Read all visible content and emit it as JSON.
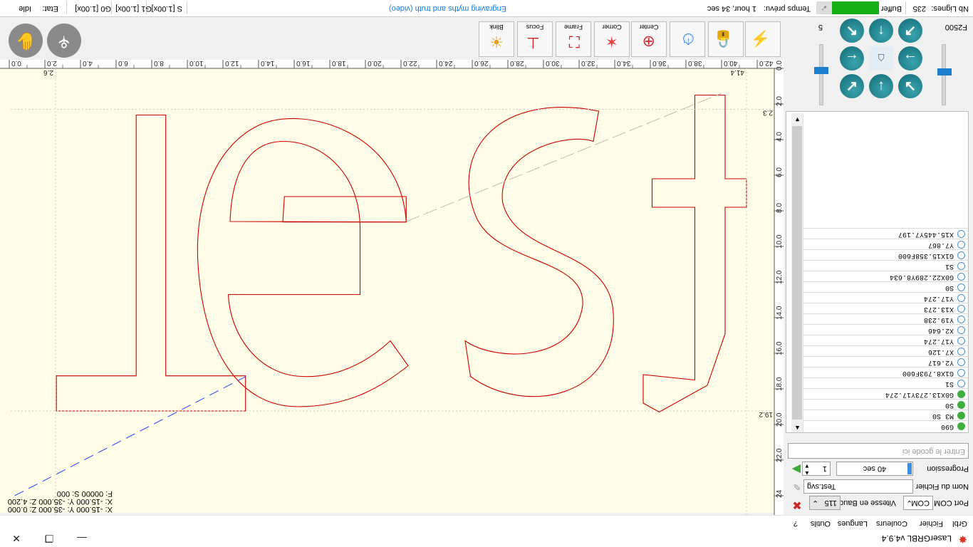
{
  "app": {
    "title": "LaserGRBL v4.9.4"
  },
  "window_controls": {
    "minimize": "—",
    "maximize": "❐",
    "close": "✕"
  },
  "menu": [
    "Grbl",
    "Fichier",
    "Couleurs",
    "Langues",
    "Outils",
    "?"
  ],
  "connection": {
    "port_label": "Port COM",
    "port_value": "COM",
    "baud_label": "Vitesse en Baud",
    "baud_value": "115"
  },
  "file": {
    "label": "Nom du Fichier",
    "value": "Test.svg"
  },
  "progress": {
    "label": "Progression",
    "time": "40 sec",
    "passes": "1"
  },
  "command_input": {
    "placeholder": "Entrer le gcode ici"
  },
  "console_lines": [
    {
      "text": "G90",
      "state": "ok"
    },
    {
      "text": "M3 S0",
      "state": "ok"
    },
    {
      "text": "S0",
      "state": "ok"
    },
    {
      "text": "G0X13.273Y17.274",
      "state": "ok"
    },
    {
      "text": "S1",
      "state": "queued"
    },
    {
      "text": "G1X8.793F600",
      "state": "queued"
    },
    {
      "text": "Y2.617",
      "state": "queued"
    },
    {
      "text": "X7.126",
      "state": "queued"
    },
    {
      "text": "Y17.274",
      "state": "queued"
    },
    {
      "text": "X2.646",
      "state": "queued"
    },
    {
      "text": "Y19.238",
      "state": "queued"
    },
    {
      "text": "X13.273",
      "state": "queued"
    },
    {
      "text": "Y17.274",
      "state": "queued"
    },
    {
      "text": "S0",
      "state": "queued"
    },
    {
      "text": "G0X22.289Y8.634",
      "state": "queued"
    },
    {
      "text": "S1",
      "state": "queued"
    },
    {
      "text": "G1X15.358F600",
      "state": "queued"
    },
    {
      "text": "Y7.867",
      "state": "queued"
    },
    {
      "text": "X15.445Y7.197",
      "state": "queued"
    }
  ],
  "jog": {
    "feed": "F2500",
    "step": "5"
  },
  "toolbar": {
    "frame": "Frame",
    "corner": "Corner",
    "center": "Center",
    "focus": "Focus",
    "blink": "Blink"
  },
  "coords": {
    "line1": "X: -15.000 Y: -35.000 Z: 0.000",
    "line2": "X: -15.000 Y: -35.000 Z: 4.200",
    "line3": "F: 00000 S: 000"
  },
  "ruler_top": [
    "0.0",
    "2.0",
    "4.0",
    "6.0",
    "8.0",
    "10.0",
    "12.0",
    "14.0",
    "16.0",
    "18.0",
    "20.0",
    "22.0",
    "24.0",
    "26.0",
    "28.0",
    "30.0",
    "32.0",
    "34.0",
    "36.0",
    "38.0",
    "40.0",
    "42.0"
  ],
  "ruler_left": [
    "0.0",
    "2.0",
    "4.0",
    "6.0",
    "8.0",
    "10.0",
    "12.0",
    "14.0",
    "16.0",
    "18.0",
    "20.0",
    "22.0",
    "24"
  ],
  "dimensions": {
    "width_max": "41.4",
    "x_min": "2.6",
    "y_min": "2.3",
    "y_max": "19.2"
  },
  "status": {
    "lines_label": "Nb Lignes:",
    "lines_value": "235",
    "buffer_label": "Buffer",
    "time_label": "Temps prévu:",
    "time_value": "1 hour, 34 sec",
    "link": "Engraving myths and truth (video)",
    "s_override": "S [1.00x]",
    "g1_override": "G1 [1.00x]",
    "g0_override": "G0 [1.00x]",
    "state_label": "Etat:",
    "state_value": "Idle"
  },
  "colors": {
    "canvas_bg": "#fffde8",
    "path": "#cc0000",
    "rapid": "#3050ff",
    "buffer": "#16b016"
  }
}
